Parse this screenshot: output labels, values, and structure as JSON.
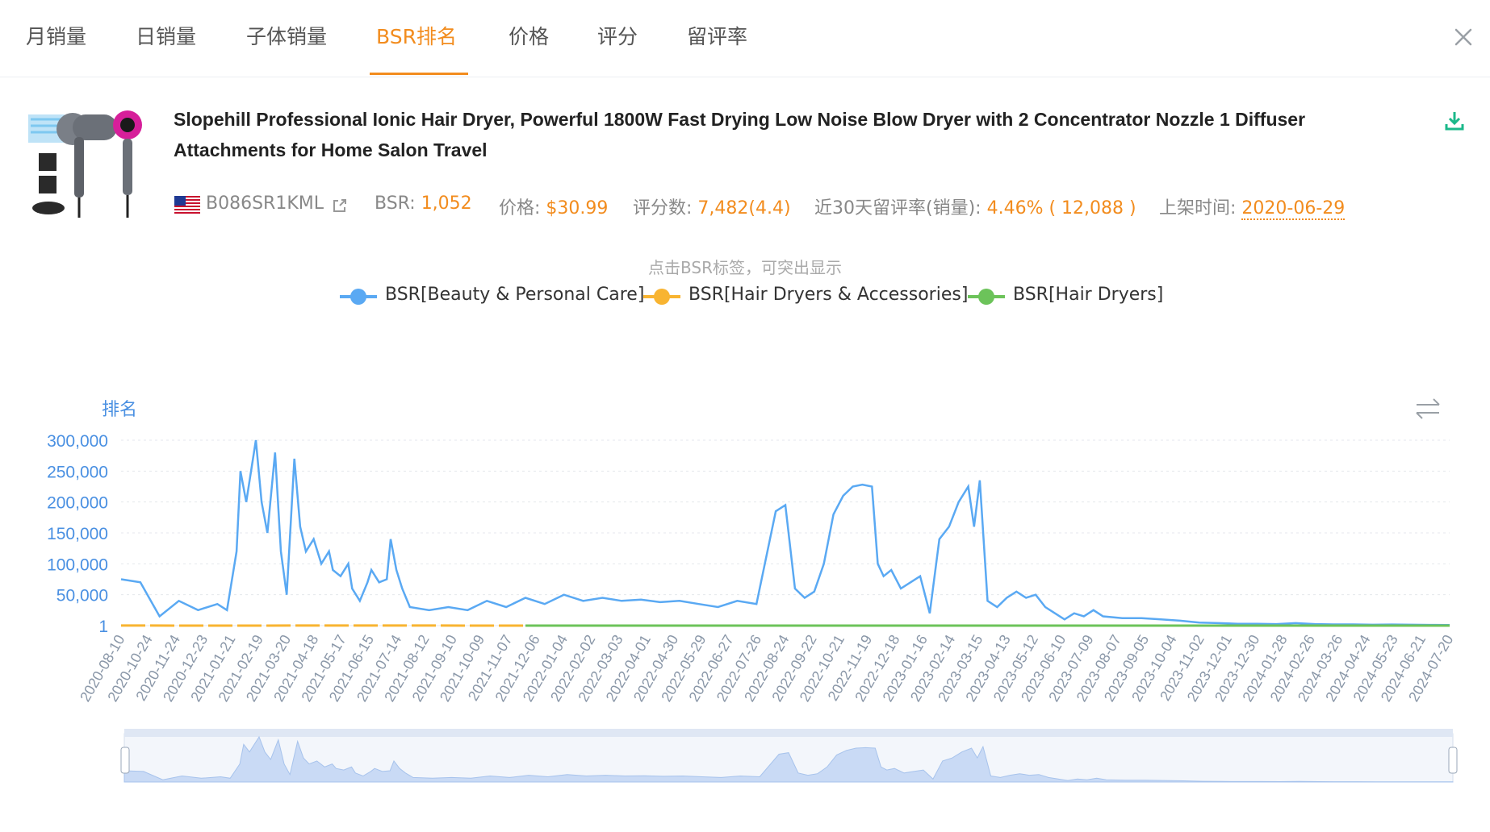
{
  "tabs": [
    "月销量",
    "日销量",
    "子体销量",
    "BSR排名",
    "价格",
    "评分",
    "留评率"
  ],
  "active_tab": "BSR排名",
  "product": {
    "title": "Slopehill Professional Ionic Hair Dryer, Powerful 1800W Fast Drying Low Noise Blow Dryer with 2 Concentrator Nozzle 1 Diffuser Attachments for Home Salon Travel",
    "asin": "B086SR1KML",
    "bsr_label": "BSR: ",
    "bsr_value": "1,052",
    "price_label": "价格: ",
    "price_value": "$30.99",
    "ratings_label": "评分数: ",
    "ratings_value": "7,482(4.4)",
    "review_rate_label": "近30天留评率(销量): ",
    "review_rate_value": "4.46% ( 12,088 )",
    "listed_label": "上架时间: ",
    "listed_value": "2020-06-29"
  },
  "chart_hint": "点击BSR标签，可突出显示",
  "icons": {
    "close": "close-icon",
    "download": "download-icon",
    "flag": "us-flag-icon",
    "external": "external-link-icon",
    "switch": "swap-icon"
  },
  "colors": {
    "accent": "#f28c1e",
    "beauty": "#5aa9f3",
    "hair_accessories": "#f8b431",
    "hair_dryers": "#6cc35a"
  },
  "chart_data": {
    "type": "line",
    "ylabel": "排名",
    "yticks": [
      "300,000",
      "250,000",
      "200,000",
      "150,000",
      "100,000",
      "50,000",
      "1"
    ],
    "ylim": [
      1,
      300000
    ],
    "legend": [
      "BSR[Beauty & Personal Care]",
      "BSR[Hair Dryers & Accessories]",
      "BSR[Hair Dryers]"
    ],
    "x_labels": [
      "2020-08-10",
      "2020-10-24",
      "2020-11-24",
      "2020-12-23",
      "2021-01-21",
      "2021-02-19",
      "2021-03-20",
      "2021-04-18",
      "2021-05-17",
      "2021-06-15",
      "2021-07-14",
      "2021-08-12",
      "2021-09-10",
      "2021-10-09",
      "2021-11-07",
      "2021-12-06",
      "2022-01-04",
      "2022-02-02",
      "2022-03-03",
      "2022-04-01",
      "2022-04-30",
      "2022-05-29",
      "2022-06-27",
      "2022-07-26",
      "2022-08-24",
      "2022-09-22",
      "2022-10-21",
      "2022-11-19",
      "2022-12-18",
      "2023-01-16",
      "2023-02-14",
      "2023-03-15",
      "2023-04-13",
      "2023-05-12",
      "2023-06-10",
      "2023-07-09",
      "2023-08-07",
      "2023-09-05",
      "2023-10-04",
      "2023-11-02",
      "2023-12-01",
      "2023-12-30",
      "2024-01-28",
      "2024-02-26",
      "2024-03-26",
      "2024-04-24",
      "2024-05-23",
      "2024-06-21",
      "2024-07-20"
    ],
    "series": [
      {
        "name": "BSR[Beauty & Personal Care]",
        "color": "#5aa9f3",
        "points": [
          [
            0,
            75000
          ],
          [
            1,
            70000
          ],
          [
            2,
            15000
          ],
          [
            3,
            40000
          ],
          [
            4,
            25000
          ],
          [
            5,
            35000
          ],
          [
            5.5,
            25000
          ],
          [
            6,
            120000
          ],
          [
            6.2,
            250000
          ],
          [
            6.5,
            200000
          ],
          [
            7,
            300000
          ],
          [
            7.3,
            200000
          ],
          [
            7.6,
            150000
          ],
          [
            8,
            280000
          ],
          [
            8.3,
            120000
          ],
          [
            8.6,
            50000
          ],
          [
            9,
            270000
          ],
          [
            9.3,
            160000
          ],
          [
            9.6,
            120000
          ],
          [
            10,
            140000
          ],
          [
            10.4,
            100000
          ],
          [
            10.8,
            120000
          ],
          [
            11,
            90000
          ],
          [
            11.4,
            80000
          ],
          [
            11.8,
            100000
          ],
          [
            12,
            60000
          ],
          [
            12.4,
            40000
          ],
          [
            12.8,
            70000
          ],
          [
            13,
            90000
          ],
          [
            13.4,
            70000
          ],
          [
            13.8,
            75000
          ],
          [
            14,
            140000
          ],
          [
            14.3,
            90000
          ],
          [
            14.6,
            60000
          ],
          [
            15,
            30000
          ],
          [
            16,
            25000
          ],
          [
            17,
            30000
          ],
          [
            18,
            25000
          ],
          [
            19,
            40000
          ],
          [
            20,
            30000
          ],
          [
            21,
            45000
          ],
          [
            22,
            35000
          ],
          [
            23,
            50000
          ],
          [
            24,
            40000
          ],
          [
            25,
            45000
          ],
          [
            26,
            40000
          ],
          [
            27,
            42000
          ],
          [
            28,
            38000
          ],
          [
            29,
            40000
          ],
          [
            30,
            35000
          ],
          [
            31,
            30000
          ],
          [
            32,
            40000
          ],
          [
            33,
            35000
          ],
          [
            34,
            185000
          ],
          [
            34.5,
            195000
          ],
          [
            35,
            60000
          ],
          [
            35.5,
            45000
          ],
          [
            36,
            55000
          ],
          [
            36.5,
            100000
          ],
          [
            37,
            180000
          ],
          [
            37.5,
            210000
          ],
          [
            38,
            225000
          ],
          [
            38.5,
            228000
          ],
          [
            39,
            225000
          ],
          [
            39.3,
            100000
          ],
          [
            39.6,
            80000
          ],
          [
            40,
            90000
          ],
          [
            40.5,
            60000
          ],
          [
            41,
            70000
          ],
          [
            41.5,
            80000
          ],
          [
            42,
            20000
          ],
          [
            42.5,
            140000
          ],
          [
            43,
            160000
          ],
          [
            43.5,
            200000
          ],
          [
            44,
            225000
          ],
          [
            44.3,
            160000
          ],
          [
            44.6,
            235000
          ],
          [
            45,
            40000
          ],
          [
            45.5,
            30000
          ],
          [
            46,
            45000
          ],
          [
            46.5,
            55000
          ],
          [
            47,
            45000
          ],
          [
            47.5,
            50000
          ],
          [
            48,
            30000
          ],
          [
            48.5,
            20000
          ],
          [
            49,
            10000
          ],
          [
            49.5,
            20000
          ],
          [
            50,
            15000
          ],
          [
            50.5,
            25000
          ],
          [
            51,
            15000
          ],
          [
            52,
            12000
          ],
          [
            53,
            12000
          ],
          [
            54,
            10000
          ],
          [
            55,
            8000
          ],
          [
            56,
            5000
          ],
          [
            57,
            4000
          ],
          [
            58,
            3000
          ],
          [
            59,
            3000
          ],
          [
            60,
            2500
          ],
          [
            61,
            4000
          ],
          [
            62,
            2500
          ],
          [
            63,
            2000
          ],
          [
            64,
            2000
          ],
          [
            65,
            1500
          ],
          [
            66,
            1800
          ],
          [
            67,
            1500
          ],
          [
            68,
            1200
          ],
          [
            69,
            1052
          ]
        ]
      },
      {
        "name": "BSR[Hair Dryers & Accessories]",
        "color": "#f8b431",
        "points": [
          [
            0,
            80
          ],
          [
            5,
            60
          ],
          [
            10,
            70
          ],
          [
            15,
            90
          ],
          [
            20,
            60
          ],
          [
            21,
            50
          ]
        ]
      },
      {
        "name": "BSR[Hair Dryers]",
        "color": "#6cc35a",
        "points": [
          [
            21,
            40
          ],
          [
            30,
            30
          ],
          [
            40,
            45
          ],
          [
            50,
            30
          ],
          [
            60,
            20
          ],
          [
            69,
            15
          ]
        ]
      }
    ],
    "x_max": 69,
    "grid": true,
    "legend_position": "top"
  }
}
